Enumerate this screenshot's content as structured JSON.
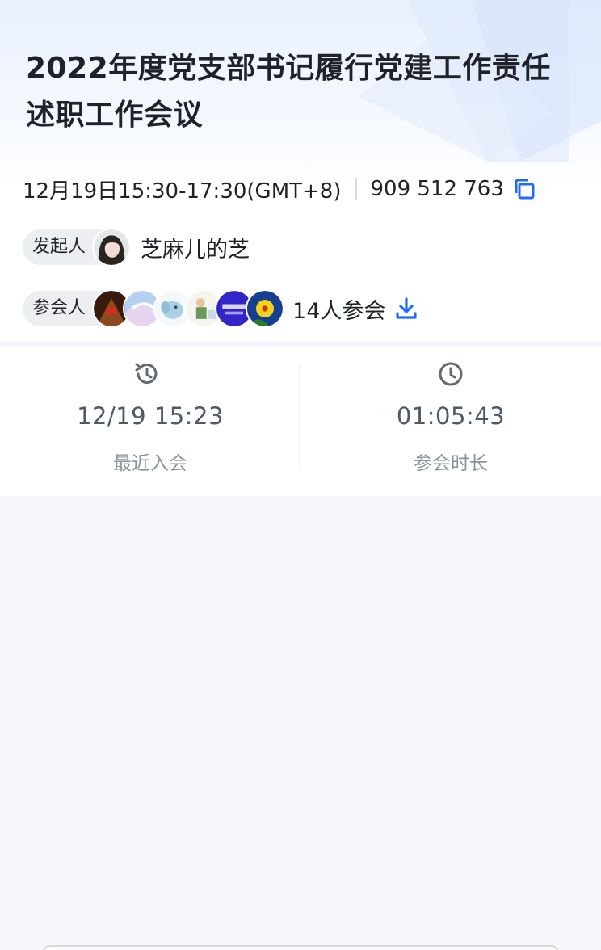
{
  "meeting": {
    "title": "2022年度党支部书记履行党建工作责任述职工作会议",
    "time": "12月19日15:30-17:30(GMT+8)",
    "meeting_id": "909 512 763"
  },
  "host": {
    "tag": "发起人",
    "name": "芝麻儿的芝"
  },
  "attendees": {
    "tag": "参会人",
    "count_label": "14人参会",
    "avatar_colors": [
      "#6b2e12",
      "#a9c6ee",
      "#cfe3f0",
      "#e8efe6",
      "#3b2fd0",
      "#1c4fa8"
    ]
  },
  "stats": {
    "recent_join": {
      "value": "12/19 15:23",
      "label": "最近入会"
    },
    "duration": {
      "value": "01:05:43",
      "label": "参会时长"
    }
  },
  "colors": {
    "accent": "#1f6bff",
    "page_bg": "#f6f7fb"
  }
}
